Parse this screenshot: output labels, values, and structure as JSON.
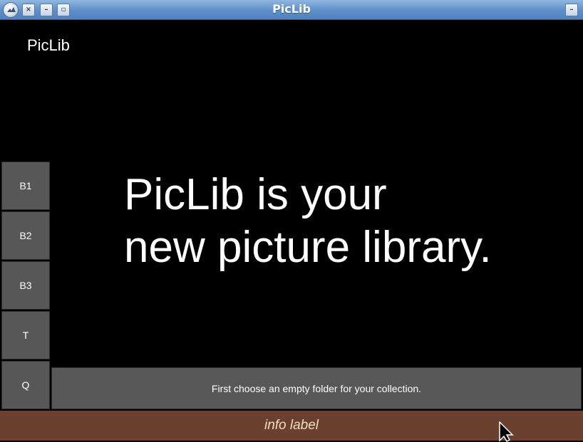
{
  "window": {
    "title": "PicLib",
    "controls": {
      "close": "×",
      "minimize": "–",
      "maximize": "▫",
      "shade": "–"
    }
  },
  "app": {
    "title": "PicLib",
    "hero_line1": "PicLib is your",
    "hero_line2": "new picture library."
  },
  "sidebar": {
    "buttons": [
      {
        "label": "B1"
      },
      {
        "label": "B2"
      },
      {
        "label": "B3"
      },
      {
        "label": "T"
      },
      {
        "label": "Q"
      }
    ]
  },
  "action": {
    "label": "First choose an empty folder for your collection."
  },
  "info": {
    "label": "info label"
  },
  "colors": {
    "background": "#000000",
    "button": "#575757",
    "info_bar": "#6b402e",
    "info_text": "#f2ddc8"
  }
}
